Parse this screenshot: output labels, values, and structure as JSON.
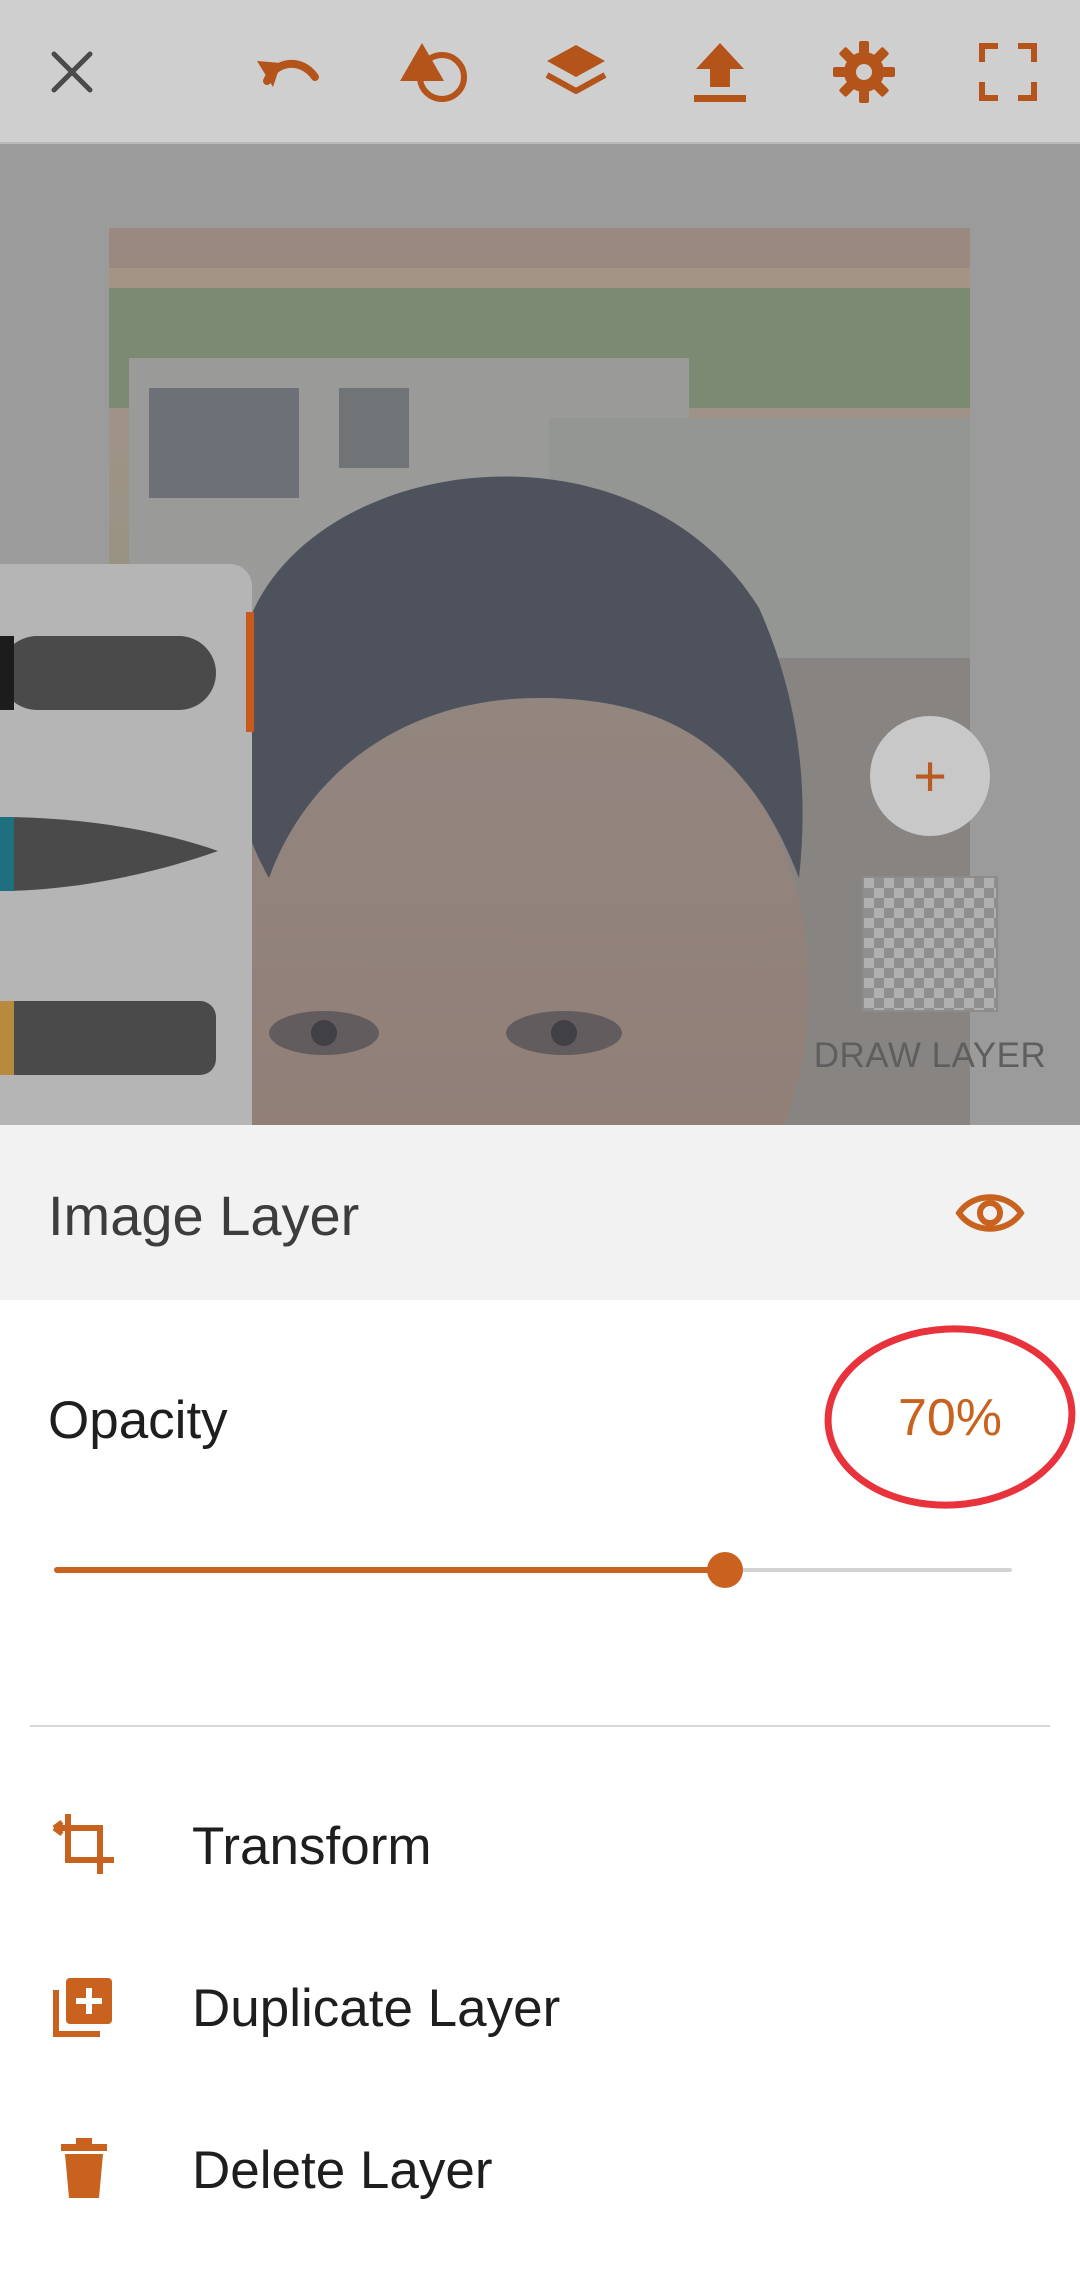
{
  "toolbar": {
    "icons": [
      "close-icon",
      "undo-icon",
      "shapes-icon",
      "layers-icon",
      "upload-icon",
      "settings-icon",
      "fullscreen-icon"
    ],
    "accent": "#c8621e"
  },
  "canvas": {
    "draw_layer_label": "DRAW LAYER",
    "add_layer_symbol": "+"
  },
  "layer_panel": {
    "title": "Image Layer",
    "opacity_label": "Opacity",
    "opacity_value": "70%",
    "opacity_fraction": 0.7
  },
  "menu": {
    "items": [
      {
        "label": "Transform",
        "icon": "crop-icon"
      },
      {
        "label": "Duplicate Layer",
        "icon": "duplicate-icon"
      },
      {
        "label": "Delete Layer",
        "icon": "trash-icon"
      }
    ]
  },
  "colors": {
    "accent": "#c8621e",
    "highlight_circle": "#e8323c"
  }
}
